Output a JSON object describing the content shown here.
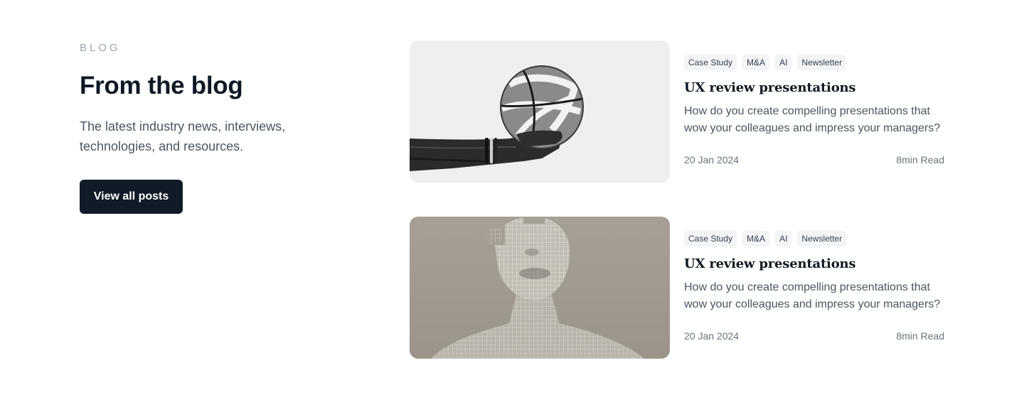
{
  "intro": {
    "eyebrow": "BLOG",
    "heading": "From the blog",
    "subtitle": "The latest industry news, interviews, technologies, and resources.",
    "cta_label": "View all posts"
  },
  "posts": [
    {
      "image": "basketball-in-hand-photo",
      "tags": [
        "Case Study",
        "M&A",
        "AI",
        "Newsletter"
      ],
      "title": "UX review presentations",
      "excerpt": "How do you create compelling presentations that wow your colleagues and impress your managers?",
      "date": "20 Jan 2024",
      "read_time": "8min Read"
    },
    {
      "image": "wireframe-head-sculpture-photo",
      "tags": [
        "Case Study",
        "M&A",
        "AI",
        "Newsletter"
      ],
      "title": "UX review presentations",
      "excerpt": "How do you create compelling presentations that wow your colleagues and impress your managers?",
      "date": "20 Jan 2024",
      "read_time": "8min Read"
    }
  ],
  "colors": {
    "button_bg": "#101b27",
    "heading": "#0f1923",
    "tag_bg": "#f3f4f6",
    "muted_text": "#6b7280"
  }
}
